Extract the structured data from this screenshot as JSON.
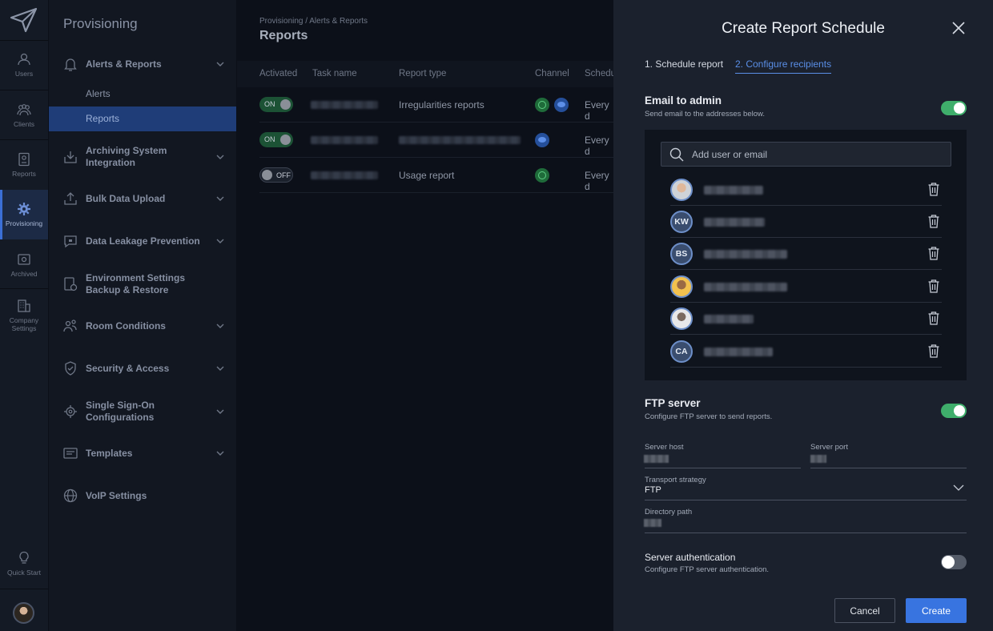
{
  "rail": {
    "items": [
      {
        "label": "Users",
        "icon": "users-icon"
      },
      {
        "label": "Clients",
        "icon": "clients-icon"
      },
      {
        "label": "Reports",
        "icon": "reports-icon"
      },
      {
        "label": "Provisioning",
        "icon": "gear-icon"
      },
      {
        "label": "Archived",
        "icon": "archive-icon"
      },
      {
        "label": "Company Settings",
        "icon": "company-icon"
      },
      {
        "label": "Quick Start",
        "icon": "lightbulb-icon"
      }
    ]
  },
  "sidebar": {
    "title": "Provisioning",
    "items": [
      {
        "label": "Alerts & Reports",
        "icon": "bell-icon"
      },
      {
        "label": "Archiving System Integration",
        "icon": "archive-download-icon"
      },
      {
        "label": "Bulk Data Upload",
        "icon": "upload-icon"
      },
      {
        "label": "Data Leakage Prevention",
        "icon": "chat-lock-icon"
      },
      {
        "label": "Environment Settings Backup & Restore",
        "icon": "backup-icon"
      },
      {
        "label": "Room Conditions",
        "icon": "people-icon"
      },
      {
        "label": "Security & Access",
        "icon": "shield-icon"
      },
      {
        "label": "Single Sign-On Configurations",
        "icon": "sso-gear-icon"
      },
      {
        "label": "Templates",
        "icon": "template-icon"
      },
      {
        "label": "VoIP Settings",
        "icon": "globe-icon"
      }
    ],
    "subitems": [
      {
        "label": "Alerts"
      },
      {
        "label": "Reports"
      }
    ]
  },
  "main": {
    "breadcrumb": "Provisioning / Alerts & Reports",
    "title": "Reports",
    "columns": [
      "Activated",
      "Task name",
      "Report type",
      "Channel",
      "Schedu"
    ],
    "rows": [
      {
        "toggle": "ON",
        "report_type": "Irregularities reports",
        "schedule": "Every d"
      },
      {
        "toggle": "ON",
        "report_type": "",
        "schedule": "Every d"
      },
      {
        "toggle": "OFF",
        "report_type": "Usage report",
        "schedule": "Every d"
      }
    ]
  },
  "drawer": {
    "title": "Create Report Schedule",
    "steps": [
      "1. Schedule report",
      "2. Configure recipients"
    ],
    "email": {
      "title": "Email to admin",
      "desc": "Send email to the addresses below.",
      "enabled": true,
      "search_placeholder": "Add user or email",
      "recipients": [
        {
          "initials": ""
        },
        {
          "initials": "KW"
        },
        {
          "initials": "BS"
        },
        {
          "initials": ""
        },
        {
          "initials": ""
        },
        {
          "initials": "CA"
        }
      ]
    },
    "ftp": {
      "title": "FTP server",
      "desc": "Configure FTP server to send reports.",
      "enabled": true,
      "host_label": "Server host",
      "port_label": "Server port",
      "transport_label": "Transport strategy",
      "transport_value": "FTP",
      "path_label": "Directory path"
    },
    "auth": {
      "title": "Server authentication",
      "desc": "Configure FTP server authentication.",
      "enabled": false
    },
    "cancel_label": "Cancel",
    "create_label": "Create"
  },
  "colors": {
    "accent": "#3874e0",
    "switch_on": "#3fae6b",
    "sidebar_active": "#1f3d78"
  }
}
